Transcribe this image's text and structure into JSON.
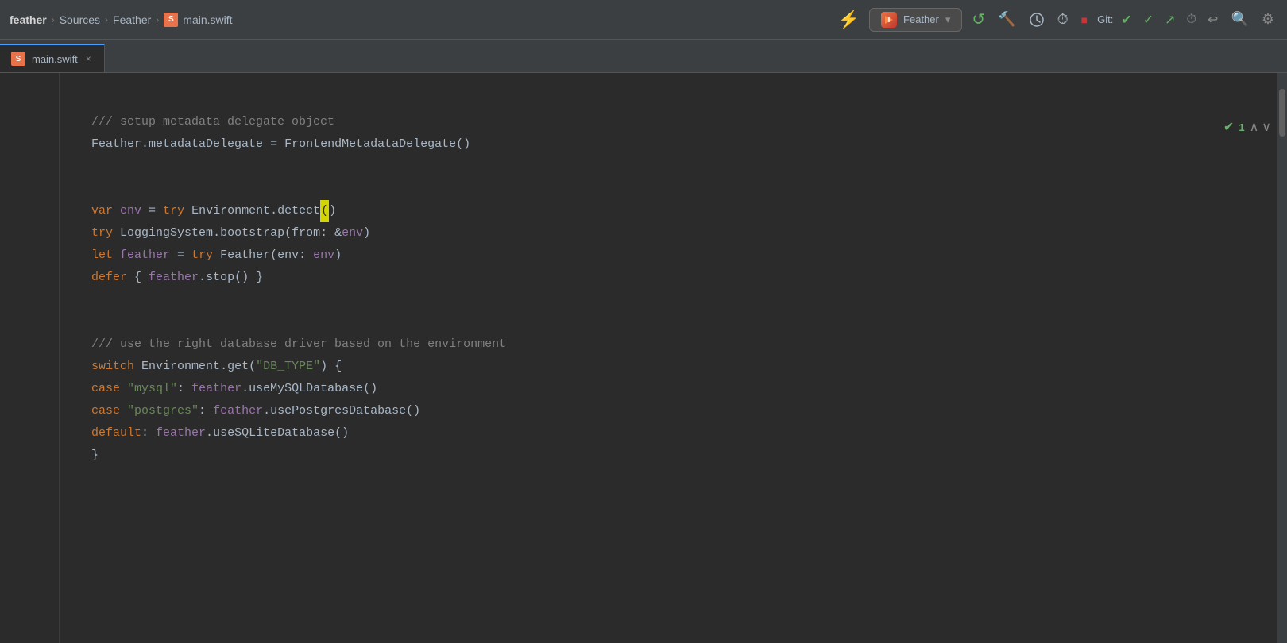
{
  "toolbar": {
    "project_name": "feather",
    "breadcrumb": [
      "feather",
      "Sources",
      "Feather"
    ],
    "file_name": "main.swift",
    "run_target": "Feather",
    "git_label": "Git:",
    "issue_count": "1"
  },
  "tab": {
    "label": "main.swift",
    "close_label": "×"
  },
  "code": {
    "lines": [
      {
        "tokens": [
          {
            "t": "comment",
            "v": "/// setup metadata delegate object"
          }
        ]
      },
      {
        "tokens": [
          {
            "t": "ident",
            "v": "Feather"
          },
          {
            "t": "op",
            "v": "."
          },
          {
            "t": "method",
            "v": "metadataDelegate"
          },
          {
            "t": "op",
            "v": " = "
          },
          {
            "t": "ident",
            "v": "FrontendMetadataDelegate"
          },
          {
            "t": "paren",
            "v": "()"
          }
        ]
      },
      {
        "tokens": []
      },
      {
        "tokens": [
          {
            "t": "kw-var",
            "v": "var"
          },
          {
            "t": "op",
            "v": " "
          },
          {
            "t": "ident-var",
            "v": "env"
          },
          {
            "t": "op",
            "v": " = "
          },
          {
            "t": "kw-keyword",
            "v": "try"
          },
          {
            "t": "op",
            "v": " "
          },
          {
            "t": "ident",
            "v": "Environment"
          },
          {
            "t": "op",
            "v": "."
          },
          {
            "t": "method",
            "v": "detect"
          },
          {
            "t": "cursor",
            "v": "("
          },
          {
            "t": "paren",
            "v": ")"
          }
        ]
      },
      {
        "tokens": [
          {
            "t": "kw-keyword",
            "v": "try"
          },
          {
            "t": "op",
            "v": " "
          },
          {
            "t": "ident",
            "v": "LoggingSystem"
          },
          {
            "t": "op",
            "v": "."
          },
          {
            "t": "method",
            "v": "bootstrap"
          },
          {
            "t": "paren",
            "v": "("
          },
          {
            "t": "param-label",
            "v": "from"
          },
          {
            "t": "op",
            "v": ": "
          },
          {
            "t": "op",
            "v": "&"
          },
          {
            "t": "ident-var",
            "v": "env"
          },
          {
            "t": "paren",
            "v": ")"
          }
        ]
      },
      {
        "tokens": [
          {
            "t": "kw-keyword",
            "v": "let"
          },
          {
            "t": "op",
            "v": " "
          },
          {
            "t": "ident-var",
            "v": "feather"
          },
          {
            "t": "op",
            "v": " = "
          },
          {
            "t": "kw-keyword",
            "v": "try"
          },
          {
            "t": "op",
            "v": " "
          },
          {
            "t": "ident",
            "v": "Feather"
          },
          {
            "t": "paren",
            "v": "("
          },
          {
            "t": "param-label",
            "v": "env"
          },
          {
            "t": "op",
            "v": ": "
          },
          {
            "t": "ident-var",
            "v": "env"
          },
          {
            "t": "paren",
            "v": ")"
          }
        ]
      },
      {
        "tokens": [
          {
            "t": "kw-keyword",
            "v": "defer"
          },
          {
            "t": "op",
            "v": " { "
          },
          {
            "t": "ident-var",
            "v": "feather"
          },
          {
            "t": "op",
            "v": "."
          },
          {
            "t": "method",
            "v": "stop"
          },
          {
            "t": "paren",
            "v": "()"
          },
          {
            "t": "op",
            "v": " }"
          }
        ]
      },
      {
        "tokens": []
      },
      {
        "tokens": [
          {
            "t": "comment",
            "v": "/// use the right database driver based on the environment"
          }
        ]
      },
      {
        "tokens": [
          {
            "t": "kw-keyword",
            "v": "switch"
          },
          {
            "t": "op",
            "v": " "
          },
          {
            "t": "ident",
            "v": "Environment"
          },
          {
            "t": "op",
            "v": "."
          },
          {
            "t": "method",
            "v": "get"
          },
          {
            "t": "paren",
            "v": "("
          },
          {
            "t": "string",
            "v": "\"DB_TYPE\""
          },
          {
            "t": "paren",
            "v": ")"
          },
          {
            "t": "op",
            "v": " {"
          }
        ]
      },
      {
        "tokens": [
          {
            "t": "kw-keyword",
            "v": "case"
          },
          {
            "t": "op",
            "v": " "
          },
          {
            "t": "string",
            "v": "\"mysql\""
          },
          {
            "t": "op",
            "v": ": "
          },
          {
            "t": "ident-var",
            "v": "feather"
          },
          {
            "t": "op",
            "v": "."
          },
          {
            "t": "method",
            "v": "useMySQLDatabase"
          },
          {
            "t": "paren",
            "v": "()"
          }
        ]
      },
      {
        "tokens": [
          {
            "t": "kw-keyword",
            "v": "case"
          },
          {
            "t": "op",
            "v": " "
          },
          {
            "t": "string",
            "v": "\"postgres\""
          },
          {
            "t": "op",
            "v": ": "
          },
          {
            "t": "ident-var",
            "v": "feather"
          },
          {
            "t": "op",
            "v": "."
          },
          {
            "t": "method",
            "v": "usePostgresDatabase"
          },
          {
            "t": "paren",
            "v": "()"
          }
        ]
      },
      {
        "tokens": [
          {
            "t": "kw-keyword",
            "v": "default"
          },
          {
            "t": "op",
            "v": ": "
          },
          {
            "t": "ident-var",
            "v": "feather"
          },
          {
            "t": "op",
            "v": "."
          },
          {
            "t": "method",
            "v": "useSQLiteDatabase"
          },
          {
            "t": "paren",
            "v": "()"
          }
        ]
      },
      {
        "tokens": [
          {
            "t": "op",
            "v": "}"
          }
        ]
      }
    ]
  },
  "icons": {
    "run_icon": "▶",
    "rerun_icon": "↺",
    "stop_icon": "■",
    "build_icon": "🔨",
    "check_icon": "✓",
    "up_arrow": "∧",
    "down_arrow": "∨",
    "search_icon": "🔍",
    "settings_icon": "⚙",
    "clock_icon": "⏱",
    "git_check": "✓",
    "git_checkmark": "✔",
    "git_arrow_up": "↗",
    "git_undo": "↩"
  }
}
